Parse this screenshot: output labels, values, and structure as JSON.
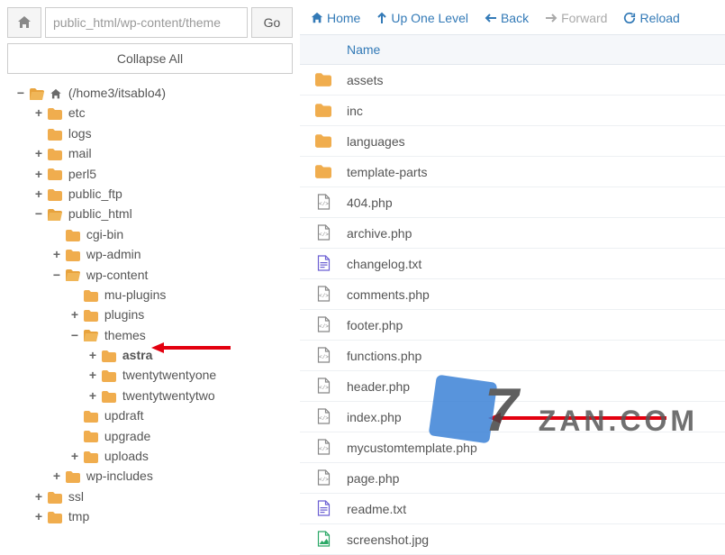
{
  "pathbar": {
    "value": "public_html/wp-content/theme",
    "go": "Go"
  },
  "collapse": "Collapse All",
  "toolbar": {
    "home": "Home",
    "up": "Up One Level",
    "back": "Back",
    "forward": "Forward",
    "reload": "Reload"
  },
  "header": {
    "name": "Name"
  },
  "tree_root": "(/home3/itsablo4)",
  "tree": {
    "etc": "etc",
    "logs": "logs",
    "mail": "mail",
    "perl5": "perl5",
    "public_ftp": "public_ftp",
    "public_html": "public_html",
    "cgi_bin": "cgi-bin",
    "wp_admin": "wp-admin",
    "wp_content": "wp-content",
    "mu_plugins": "mu-plugins",
    "plugins": "plugins",
    "themes": "themes",
    "astra": "astra",
    "tw21": "twentytwentyone",
    "tw22": "twentytwentytwo",
    "updraft": "updraft",
    "upgrade": "upgrade",
    "uploads": "uploads",
    "wp_includes": "wp-includes",
    "ssl": "ssl",
    "tmp": "tmp"
  },
  "files": [
    {
      "icon": "folder",
      "name": "assets"
    },
    {
      "icon": "folder",
      "name": "inc"
    },
    {
      "icon": "folder",
      "name": "languages"
    },
    {
      "icon": "folder",
      "name": "template-parts"
    },
    {
      "icon": "php",
      "name": "404.php"
    },
    {
      "icon": "php",
      "name": "archive.php"
    },
    {
      "icon": "txt",
      "name": "changelog.txt"
    },
    {
      "icon": "php",
      "name": "comments.php"
    },
    {
      "icon": "php",
      "name": "footer.php"
    },
    {
      "icon": "php",
      "name": "functions.php"
    },
    {
      "icon": "php",
      "name": "header.php"
    },
    {
      "icon": "php",
      "name": "index.php"
    },
    {
      "icon": "php",
      "name": "mycustomtemplate.php"
    },
    {
      "icon": "php",
      "name": "page.php"
    },
    {
      "icon": "txt",
      "name": "readme.txt"
    },
    {
      "icon": "img",
      "name": "screenshot.jpg"
    }
  ],
  "watermark": "ZAN.COM"
}
